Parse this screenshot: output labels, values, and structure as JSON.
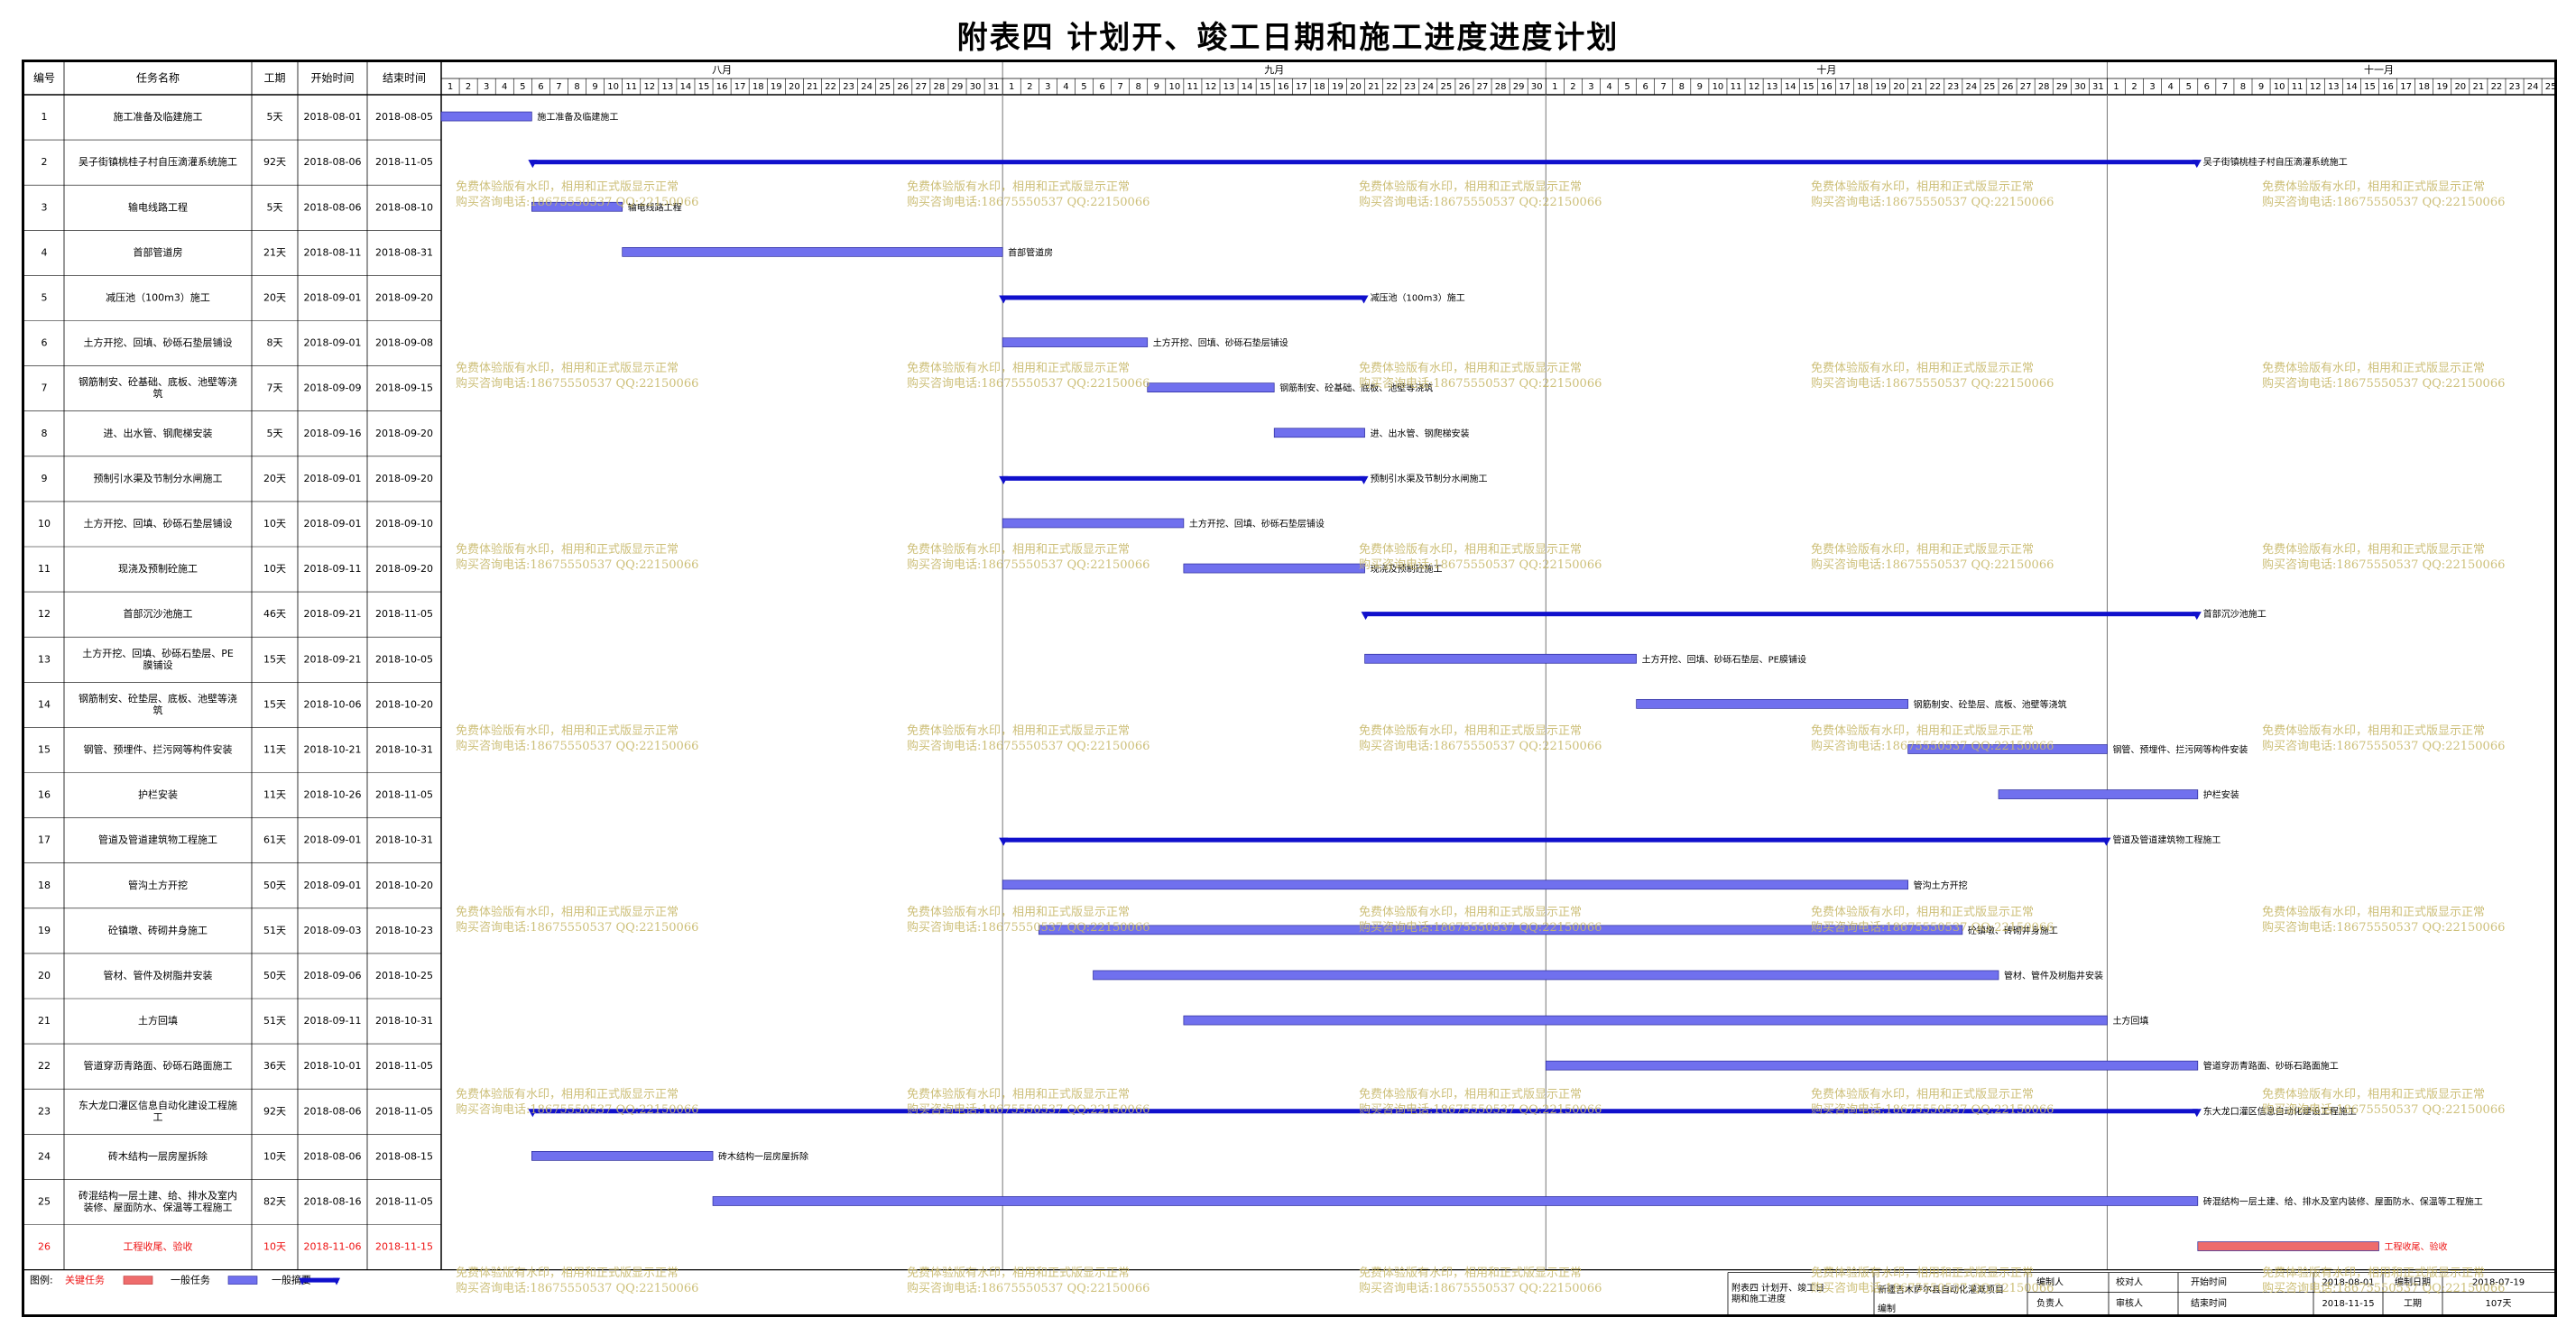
{
  "title": "附表四  计划开、竣工日期和施工进度进度计划",
  "headers": {
    "id": "编号",
    "name": "任务名称",
    "duration": "工期",
    "start": "开始时间",
    "end": "结束时间"
  },
  "months": [
    "八月",
    "九月",
    "十月",
    "十一月"
  ],
  "month_days": [
    31,
    30,
    31,
    30
  ],
  "timeline_start": "2018-08-01",
  "tasks": [
    {
      "id": "1",
      "name": "施工准备及临建施工",
      "duration": "5天",
      "start": "2018-08-01",
      "end": "2018-08-05",
      "type": "normal",
      "label": "施工准备及临建施工"
    },
    {
      "id": "2",
      "name": "吴子街镇桃桂子村自压滴灌系统施工",
      "duration": "92天",
      "start": "2018-08-06",
      "end": "2018-11-05",
      "type": "summary",
      "label": "吴子街镇桃桂子村自压滴灌系统施工"
    },
    {
      "id": "3",
      "name": "输电线路工程",
      "duration": "5天",
      "start": "2018-08-06",
      "end": "2018-08-10",
      "type": "normal",
      "label": "输电线路工程"
    },
    {
      "id": "4",
      "name": "首部管道房",
      "duration": "21天",
      "start": "2018-08-11",
      "end": "2018-08-31",
      "type": "normal",
      "label": "首部管道房"
    },
    {
      "id": "5",
      "name": "减压池（100m3）施工",
      "duration": "20天",
      "start": "2018-09-01",
      "end": "2018-09-20",
      "type": "summary",
      "label": "减压池（100m3）施工"
    },
    {
      "id": "6",
      "name": "土方开挖、回填、砂砾石垫层铺设",
      "duration": "8天",
      "start": "2018-09-01",
      "end": "2018-09-08",
      "type": "normal",
      "label": "土方开挖、回填、砂砾石垫层铺设"
    },
    {
      "id": "7",
      "name": "钢筋制安、砼基础、底板、池壁等浇筑",
      "duration": "7天",
      "start": "2018-09-09",
      "end": "2018-09-15",
      "type": "normal",
      "label": "钢筋制安、砼基础、底板、池壁等浇筑"
    },
    {
      "id": "8",
      "name": "进、出水管、钢爬梯安装",
      "duration": "5天",
      "start": "2018-09-16",
      "end": "2018-09-20",
      "type": "normal",
      "label": "进、出水管、钢爬梯安装"
    },
    {
      "id": "9",
      "name": "预制引水渠及节制分水闸施工",
      "duration": "20天",
      "start": "2018-09-01",
      "end": "2018-09-20",
      "type": "summary",
      "label": "预制引水渠及节制分水闸施工"
    },
    {
      "id": "10",
      "name": "土方开挖、回填、砂砾石垫层铺设",
      "duration": "10天",
      "start": "2018-09-01",
      "end": "2018-09-10",
      "type": "normal",
      "label": "土方开挖、回填、砂砾石垫层铺设"
    },
    {
      "id": "11",
      "name": "现浇及预制砼施工",
      "duration": "10天",
      "start": "2018-09-11",
      "end": "2018-09-20",
      "type": "normal",
      "label": "现浇及预制砼施工"
    },
    {
      "id": "12",
      "name": "首部沉沙池施工",
      "duration": "46天",
      "start": "2018-09-21",
      "end": "2018-11-05",
      "type": "summary",
      "label": "首部沉沙池施工"
    },
    {
      "id": "13",
      "name": "土方开挖、回填、砂砾石垫层、PE膜铺设",
      "duration": "15天",
      "start": "2018-09-21",
      "end": "2018-10-05",
      "type": "normal",
      "label": "土方开挖、回填、砂砾石垫层、PE膜铺设"
    },
    {
      "id": "14",
      "name": "钢筋制安、砼垫层、底板、池壁等浇筑",
      "duration": "15天",
      "start": "2018-10-06",
      "end": "2018-10-20",
      "type": "normal",
      "label": "钢筋制安、砼垫层、底板、池壁等浇筑"
    },
    {
      "id": "15",
      "name": "钢管、预埋件、拦污网等构件安装",
      "duration": "11天",
      "start": "2018-10-21",
      "end": "2018-10-31",
      "type": "normal",
      "label": "钢管、预埋件、拦污网等构件安装"
    },
    {
      "id": "16",
      "name": "护栏安装",
      "duration": "11天",
      "start": "2018-10-26",
      "end": "2018-11-05",
      "type": "normal",
      "label": "护栏安装"
    },
    {
      "id": "17",
      "name": "管道及管道建筑物工程施工",
      "duration": "61天",
      "start": "2018-09-01",
      "end": "2018-10-31",
      "type": "summary",
      "label": "管道及管道建筑物工程施工"
    },
    {
      "id": "18",
      "name": "管沟土方开挖",
      "duration": "50天",
      "start": "2018-09-01",
      "end": "2018-10-20",
      "type": "normal",
      "label": "管沟土方开挖"
    },
    {
      "id": "19",
      "name": "砼镇墩、砖砌井身施工",
      "duration": "51天",
      "start": "2018-09-03",
      "end": "2018-10-23",
      "type": "normal",
      "label": "砼镇墩、砖砌井身施工"
    },
    {
      "id": "20",
      "name": "管材、管件及树脂井安装",
      "duration": "50天",
      "start": "2018-09-06",
      "end": "2018-10-25",
      "type": "normal",
      "label": "管材、管件及树脂井安装"
    },
    {
      "id": "21",
      "name": "土方回填",
      "duration": "51天",
      "start": "2018-09-11",
      "end": "2018-10-31",
      "type": "normal",
      "label": "土方回填"
    },
    {
      "id": "22",
      "name": "管道穿沥青路面、砂砾石路面施工",
      "duration": "36天",
      "start": "2018-10-01",
      "end": "2018-11-05",
      "type": "normal",
      "label": "管道穿沥青路面、砂砾石路面施工"
    },
    {
      "id": "23",
      "name": "东大龙口灌区信息自动化建设工程施工",
      "duration": "92天",
      "start": "2018-08-06",
      "end": "2018-11-05",
      "type": "summary",
      "label": "东大龙口灌区信息自动化建设工程施工"
    },
    {
      "id": "24",
      "name": "砖木结构一层房屋拆除",
      "duration": "10天",
      "start": "2018-08-06",
      "end": "2018-08-15",
      "type": "normal",
      "label": "砖木结构一层房屋拆除"
    },
    {
      "id": "25",
      "name": "砖混结构一层土建、给、排水及室内装修、屋面防水、保温等工程施工",
      "duration": "82天",
      "start": "2018-08-16",
      "end": "2018-11-05",
      "type": "normal",
      "label": "砖混结构一层土建、给、排水及室内装修、屋面防水、保温等工程施工"
    },
    {
      "id": "26",
      "name": "工程收尾、验收",
      "duration": "10天",
      "start": "2018-11-06",
      "end": "2018-11-15",
      "type": "critical",
      "label": "工程收尾、验收"
    }
  ],
  "legend": {
    "label": "图例:",
    "critical": "关键任务",
    "normal": "一般任务",
    "summary": "一般摘要"
  },
  "footer": {
    "doc_title": "附表四  计划开、竣工日期和施工进度",
    "project": "新疆吉木萨尔县自动化灌溉项目",
    "compiler_label": "编制人",
    "compile_label": "编制",
    "checker_label": "校对人",
    "owner_label": "负责人",
    "reviewer_label": "审核人",
    "start_label": "开始时间",
    "start_value": "2018-08-01",
    "end_label": "结束时间",
    "end_value": "2018-11-15",
    "date_label": "编制日期",
    "date_value": "2018-07-19",
    "duration_label": "工期",
    "duration_value": "107天"
  },
  "colors": {
    "normal_bar": "#7070ee",
    "summary_bar": "#1010cc",
    "critical_bar": "#ee6c6c",
    "critical_text": "#ee1111",
    "watermark": "#c8b96b"
  },
  "watermark": {
    "line1": "免费体验版有水印，相用和正式版显示正常",
    "line2": "购买咨询电话:18675550537 QQ:22150066"
  }
}
